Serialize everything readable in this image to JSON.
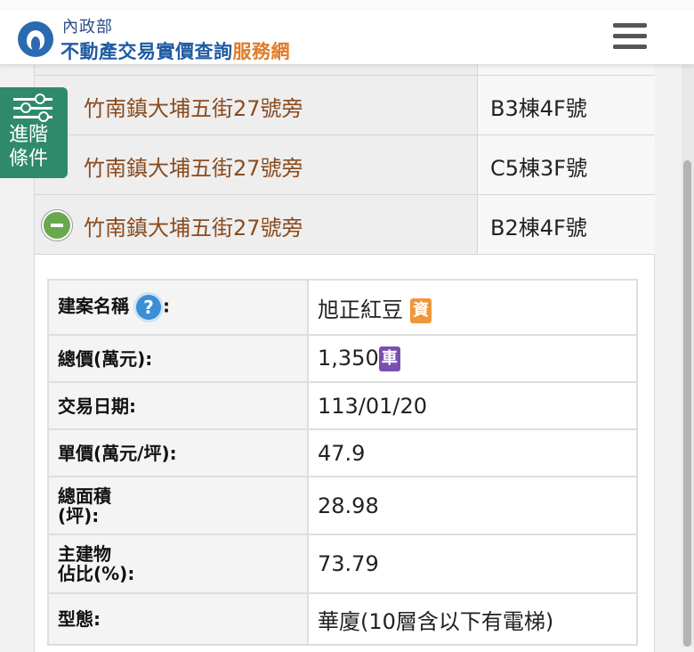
{
  "header": {
    "ministry": "內政部",
    "title_main": "不動產交易實價查詢",
    "title_accent": "服務網",
    "menu_icon": "hamburger-menu-icon"
  },
  "advanced_filter": {
    "line1": "進階",
    "line2": "條件",
    "icon": "sliders-icon"
  },
  "rows": [
    {
      "address": "竹南鎮大埔五街27號旁",
      "unit": "B3棟4F號"
    },
    {
      "address": "竹南鎮大埔五街27號旁",
      "unit": "C5棟3F號"
    },
    {
      "address": "竹南鎮大埔五街27號旁",
      "unit": "B2棟4F號",
      "expanded": true
    }
  ],
  "detail": {
    "project_name_label": "建案名稱",
    "project_name_colon": ":",
    "project_name_value": "旭正紅豆",
    "project_tag": "資",
    "total_price_label": "總價(萬元):",
    "total_price_value": "1,350",
    "total_price_tag": "車",
    "trade_date_label": "交易日期:",
    "trade_date_value": "113/01/20",
    "unit_price_label": "單價(萬元/坪):",
    "unit_price_value": "47.9",
    "total_area_label_1": "總面積",
    "total_area_label_2": "(坪):",
    "total_area_value": "28.98",
    "main_building_label_1": "主建物",
    "main_building_label_2": "佔比(%):",
    "main_building_value": "73.79",
    "type_label": "型態:",
    "type_value": "華廈(10層含以下有電梯)",
    "help_glyph": "?"
  },
  "colors": {
    "brand_blue": "#1f5ba3",
    "brand_orange": "#e07b2a",
    "address_brown": "#8a4b1e",
    "advanced_green": "#2f8a6b"
  }
}
